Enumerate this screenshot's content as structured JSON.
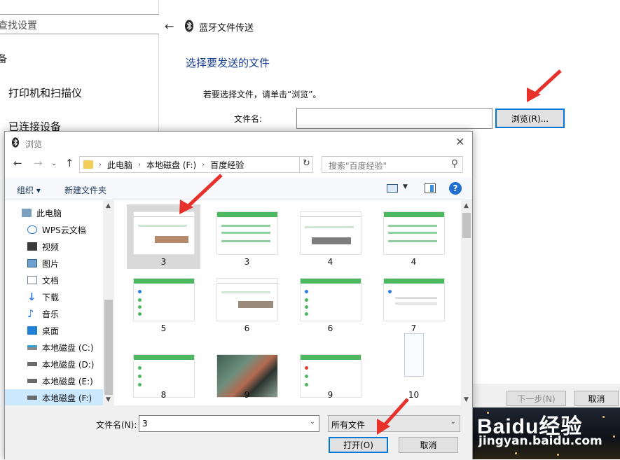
{
  "settings": {
    "search_placeholder": "查找设置",
    "section_partial": "备",
    "items": [
      "打印机和扫描仪",
      "已连接设备"
    ]
  },
  "wizard": {
    "title": "蓝牙文件传送",
    "heading": "选择要发送的文件",
    "hint": "若要选择文件，请单击“浏览”。",
    "filename_label": "文件名:",
    "browse_label": "浏览(R)...",
    "next_label": "下一步(N)",
    "cancel_label": "取消"
  },
  "watermark": {
    "logo": "Baidu经验",
    "site": "jingyan.baidu.com"
  },
  "dialog": {
    "title": "浏览",
    "breadcrumb": [
      "此电脑",
      "本地磁盘 (F:)",
      "百度经验"
    ],
    "search_placeholder": "搜索\"百度经验\"",
    "toolbar": {
      "organize": "组织 ▾",
      "new_folder": "新建文件夹"
    },
    "nav_items": [
      {
        "label": "此电脑",
        "icon": "pc-icon"
      },
      {
        "label": "WPS云文档",
        "icon": "cloud-icon"
      },
      {
        "label": "视频",
        "icon": "video-icon"
      },
      {
        "label": "图片",
        "icon": "pictures-icon"
      },
      {
        "label": "文档",
        "icon": "document-icon"
      },
      {
        "label": "下载",
        "icon": "download-icon"
      },
      {
        "label": "音乐",
        "icon": "music-icon"
      },
      {
        "label": "桌面",
        "icon": "desktop-icon"
      },
      {
        "label": "本地磁盘 (C:)",
        "icon": "drive-icon"
      },
      {
        "label": "本地磁盘 (D:)",
        "icon": "drive-icon"
      },
      {
        "label": "本地磁盘 (E:)",
        "icon": "drive-icon"
      },
      {
        "label": "本地磁盘 (F:)",
        "icon": "drive-icon"
      }
    ],
    "files": [
      "3",
      "3",
      "4",
      "4",
      "5",
      "6",
      "6",
      "7",
      "8",
      "9",
      "9",
      "10"
    ],
    "filename_label": "文件名(N):",
    "filename_value": "3",
    "filetype_value": "所有文件",
    "open_label": "打开(O)",
    "cancel_label": "取消"
  },
  "colors": {
    "accent": "#0078d7",
    "heading": "#1a3e95",
    "selection": "#cce8ff",
    "annotation": "#e8312a"
  }
}
